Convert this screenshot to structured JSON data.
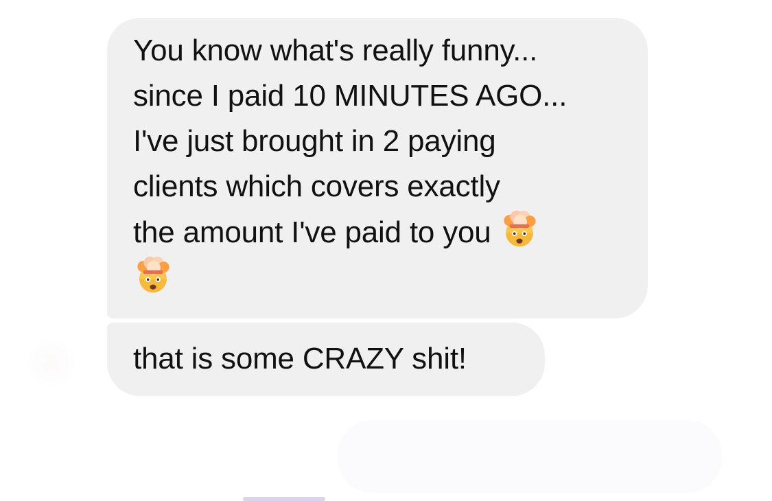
{
  "conversation": {
    "messages": [
      {
        "lines": [
          "You know what's really funny...",
          "since I paid 10 MINUTES AGO...",
          "I've just brought in 2 paying",
          "clients which covers exactly",
          "the amount I've paid to you"
        ],
        "emoji": "exploding-head"
      },
      {
        "lines": [
          "that is some CRAZY shit!"
        ]
      }
    ]
  },
  "colors": {
    "bubble_background": "#f0f0f0",
    "text": "#111111",
    "page_background": "#ffffff"
  },
  "icons": [
    "exploding-head-icon",
    "avatar"
  ]
}
